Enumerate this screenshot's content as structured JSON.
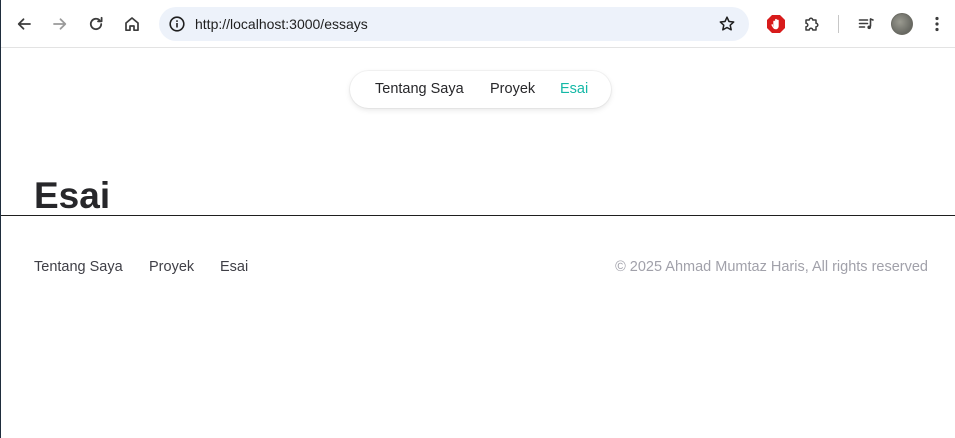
{
  "browser": {
    "url": "http://localhost:3000/essays",
    "icons": {
      "back": "arrow-left-icon",
      "forward": "arrow-right-icon",
      "reload": "reload-icon",
      "home": "home-icon",
      "site_info": "info-icon",
      "bookmark": "star-icon",
      "extension_block": "stop-hand-icon",
      "extensions": "puzzle-icon",
      "media": "media-queue-icon",
      "profile": "avatar",
      "menu": "kebab-menu-icon"
    }
  },
  "nav": {
    "items": [
      {
        "label": "Tentang Saya",
        "active": false
      },
      {
        "label": "Proyek",
        "active": false
      },
      {
        "label": "Esai",
        "active": true
      }
    ],
    "active_color": "#14b8a6"
  },
  "main": {
    "title": "Esai"
  },
  "footer": {
    "links": [
      {
        "label": "Tentang Saya"
      },
      {
        "label": "Proyek"
      },
      {
        "label": "Esai"
      }
    ],
    "copyright": "© 2025 Ahmad Mumtaz Haris, All rights reserved"
  }
}
